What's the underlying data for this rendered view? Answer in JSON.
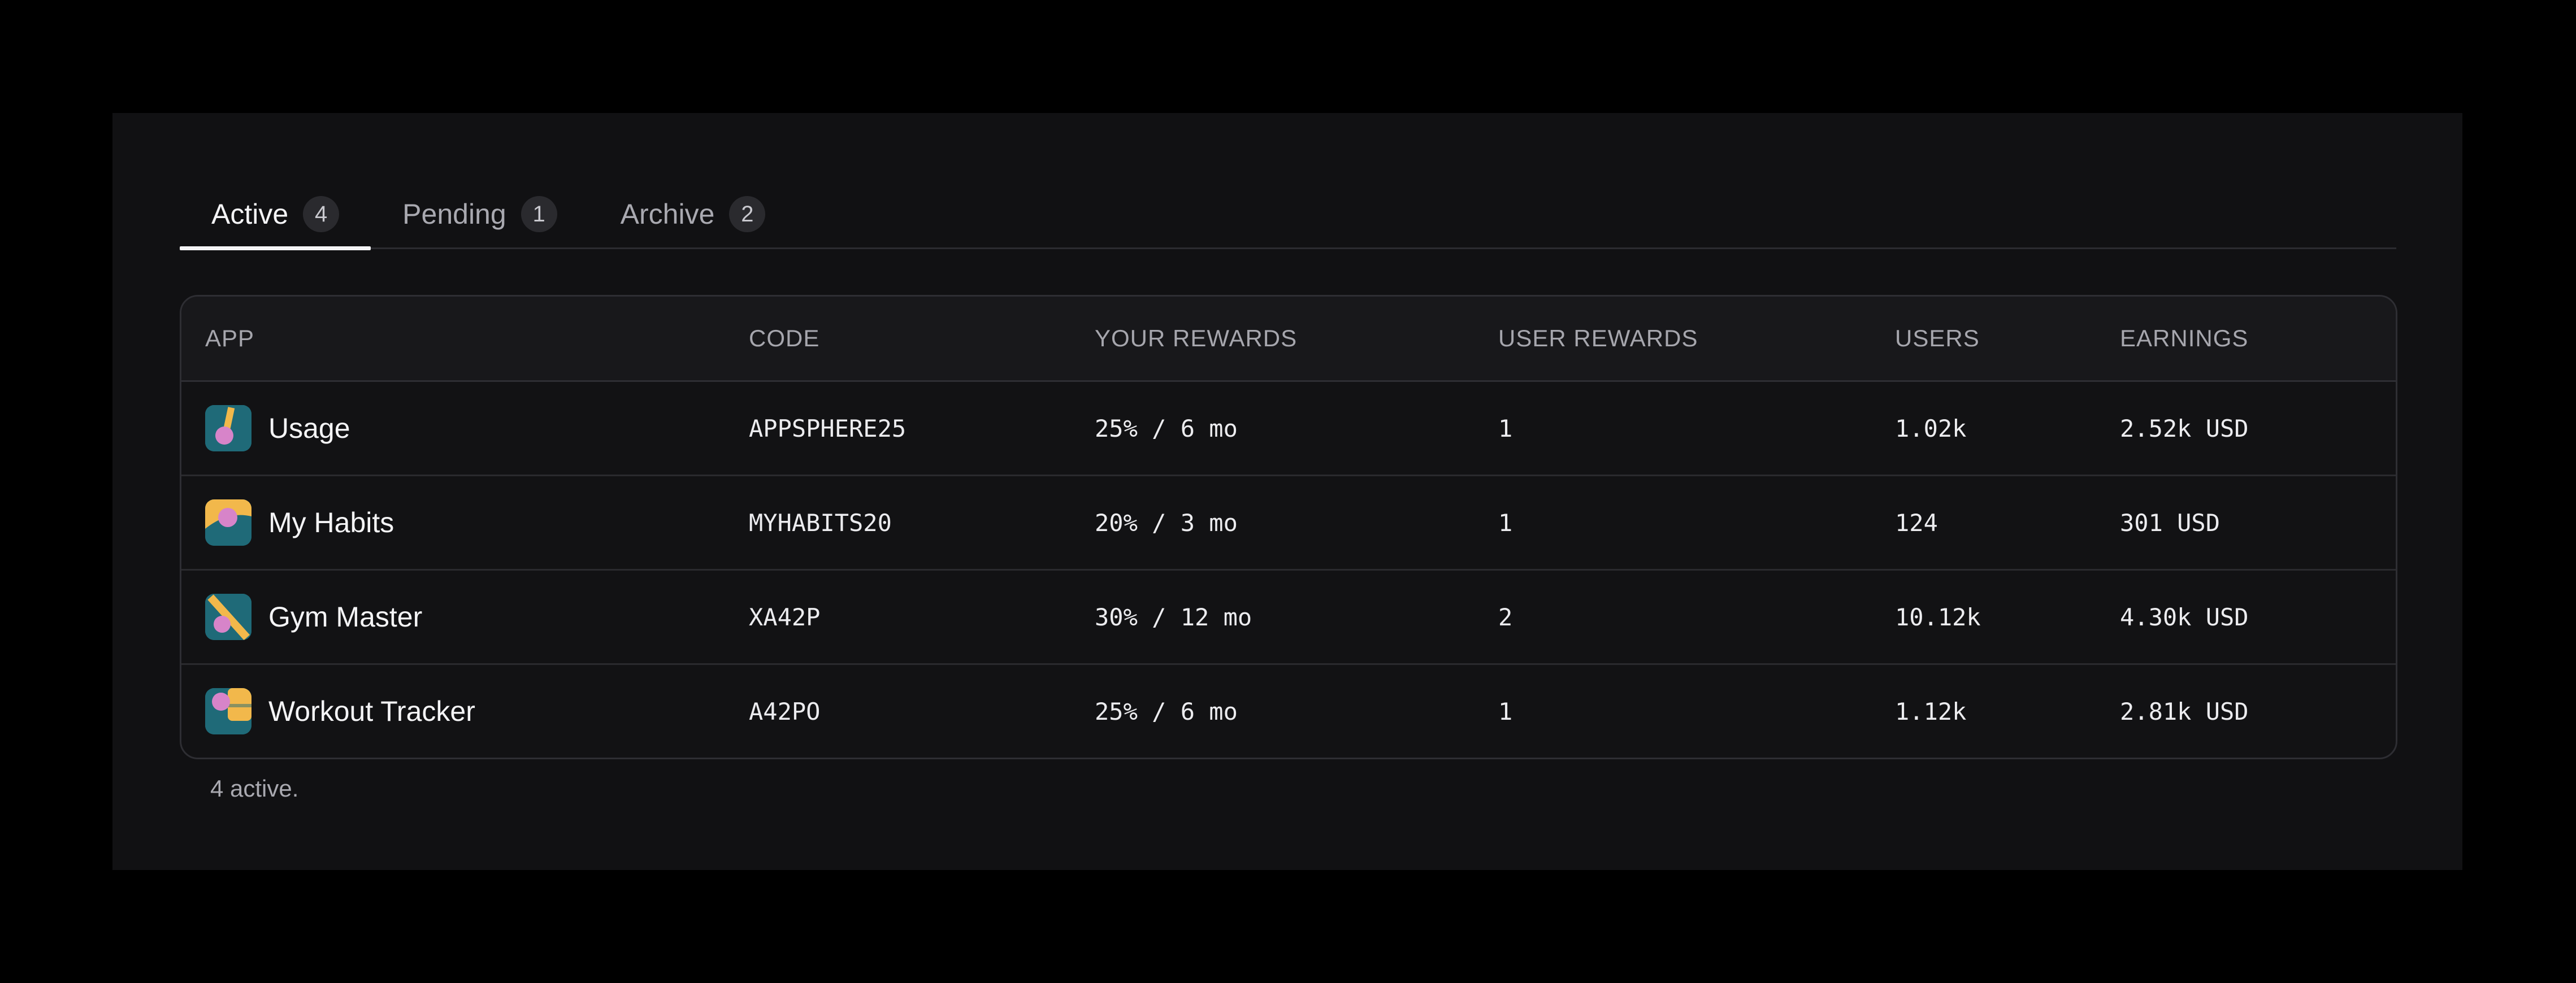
{
  "tabs": [
    {
      "label": "Active",
      "count": "4"
    },
    {
      "label": "Pending",
      "count": "1"
    },
    {
      "label": "Archive",
      "count": "2"
    }
  ],
  "table": {
    "headers": {
      "app": "APP",
      "code": "CODE",
      "your_rewards": "YOUR REWARDS",
      "user_rewards": "USER REWARDS",
      "users": "USERS",
      "earnings": "EARNINGS"
    },
    "rows": [
      {
        "app": "Usage",
        "code": "APPSPHERE25",
        "your_rewards": "25% / 6 mo",
        "user_rewards": "1",
        "users": "1.02k",
        "earnings": "2.52k USD",
        "icon": "usage-app-icon"
      },
      {
        "app": "My Habits",
        "code": "MYHABITS20",
        "your_rewards": "20% / 3 mo",
        "user_rewards": "1",
        "users": "124",
        "earnings": "301 USD",
        "icon": "my-habits-app-icon"
      },
      {
        "app": "Gym Master",
        "code": "XA42P",
        "your_rewards": "30% / 12 mo",
        "user_rewards": "2",
        "users": "10.12k",
        "earnings": "4.30k USD",
        "icon": "gym-master-app-icon"
      },
      {
        "app": "Workout Tracker",
        "code": "A42PO",
        "your_rewards": "25% / 6 mo",
        "user_rewards": "1",
        "users": "1.12k",
        "earnings": "2.81k USD",
        "icon": "workout-tracker-app-icon"
      }
    ]
  },
  "footer": {
    "summary": "4 active."
  },
  "colors": {
    "background": "#000000",
    "panel": "#111113",
    "icon_teal": "#1f6a78",
    "icon_pink": "#d784c9",
    "icon_yellow": "#f2b84b"
  }
}
